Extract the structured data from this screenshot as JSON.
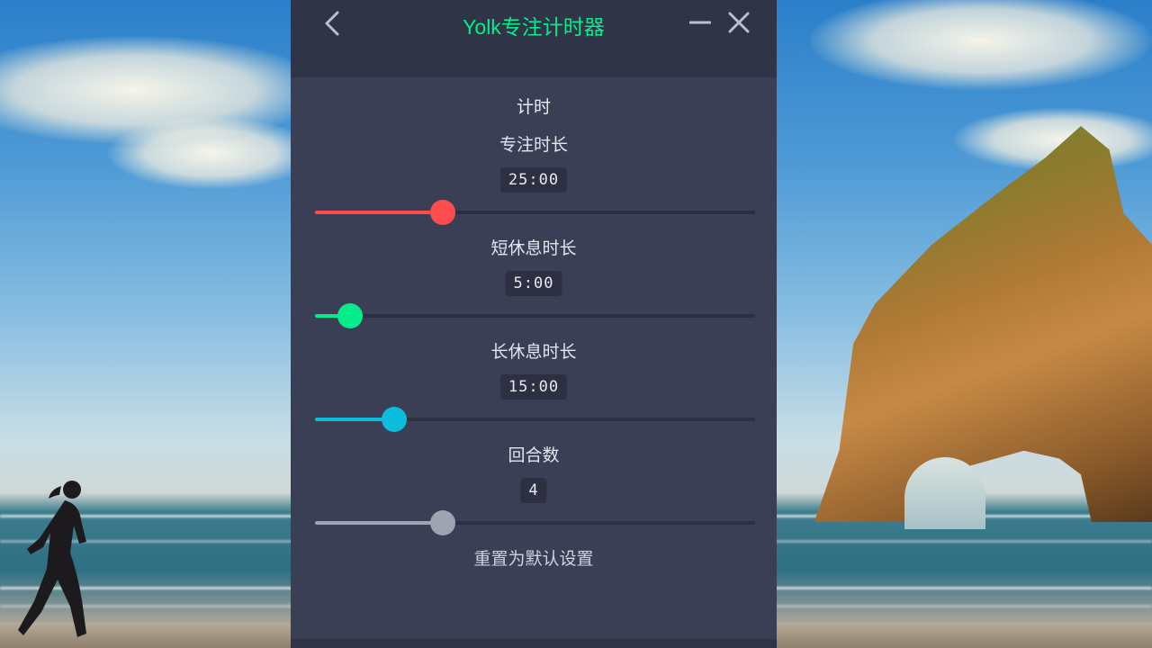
{
  "app": {
    "title": "Yolk专注计时器",
    "accent_color": "#05ec8c",
    "icons": {
      "back": "chevron-left-icon",
      "minimize": "minimize-icon",
      "close": "close-icon"
    }
  },
  "section": {
    "title": "计时"
  },
  "settings": [
    {
      "label": "专注时长",
      "value": "25:00",
      "level": 0.29,
      "color": "#ff4c4c"
    },
    {
      "label": "短休息时长",
      "value": "5:00",
      "level": 0.08,
      "color": "#05ec8c"
    },
    {
      "label": "长休息时长",
      "value": "15:00",
      "level": 0.18,
      "color": "#0bbddb"
    },
    {
      "label": "回合数",
      "value": "4",
      "level": 0.29,
      "color": "#a0a3b1"
    }
  ],
  "reset": {
    "label": "重置为默认设置"
  }
}
